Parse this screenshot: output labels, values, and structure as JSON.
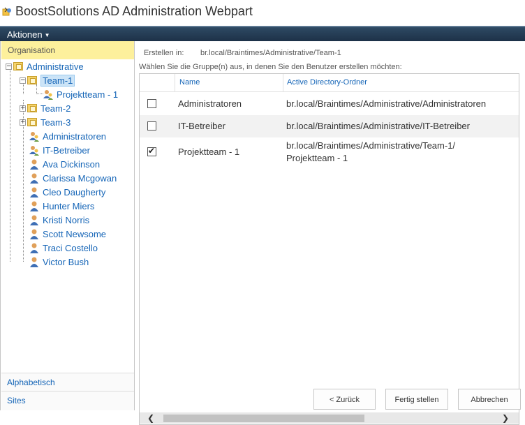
{
  "window": {
    "title": "BoostSolutions AD Administration Webpart",
    "icon": "app-logo-icon"
  },
  "menu": {
    "actions_label": "Aktionen"
  },
  "left": {
    "header": "Organisation",
    "tree": [
      {
        "label": "Administrative",
        "type": "folder",
        "toggle": "−"
      },
      {
        "label": "Team-1",
        "type": "folder",
        "toggle": "−",
        "selected": true
      },
      {
        "label": "Projektteam - 1",
        "type": "group"
      },
      {
        "label": "Team-2",
        "type": "folder",
        "toggle": "+"
      },
      {
        "label": "Team-3",
        "type": "folder",
        "toggle": "+"
      },
      {
        "label": "Administratoren",
        "type": "group"
      },
      {
        "label": "IT-Betreiber",
        "type": "group"
      },
      {
        "label": "Ava Dickinson",
        "type": "user"
      },
      {
        "label": "Clarissa Mcgowan",
        "type": "user"
      },
      {
        "label": "Cleo Daugherty",
        "type": "user"
      },
      {
        "label": "Hunter Miers",
        "type": "user"
      },
      {
        "label": "Kristi Norris",
        "type": "user"
      },
      {
        "label": "Scott Newsome",
        "type": "user"
      },
      {
        "label": "Traci Costello",
        "type": "user"
      },
      {
        "label": "Victor Bush",
        "type": "user"
      }
    ],
    "footer_alphabetical": "Alphabetisch",
    "footer_sites": "Sites"
  },
  "right": {
    "create_in_label": "Erstellen in:",
    "create_in_path": "br.local/Braintimes/Administrative/Team-1",
    "instruction": "Wählen Sie die Gruppe(n) aus, in denen Sie den Benutzer erstellen möchten:",
    "columns": {
      "name": "Name",
      "folder": "Active Directory-Ordner"
    },
    "rows": [
      {
        "checked": false,
        "name": "Administratoren",
        "folder_line1": "br.local/Braintimes/Administrative/Administratoren",
        "folder_line2": ""
      },
      {
        "checked": false,
        "name": "IT-Betreiber",
        "folder_line1": "br.local/Braintimes/Administrative/IT-Betreiber",
        "folder_line2": ""
      },
      {
        "checked": true,
        "name": "Projektteam - 1",
        "folder_line1": "br.local/Braintimes/Administrative/Team-1/",
        "folder_line2": "Projektteam - 1"
      }
    ],
    "scroll_left": "❮",
    "scroll_right": "❯"
  },
  "buttons": {
    "back": "< Zurück",
    "finish": "Fertig stellen",
    "cancel": "Abbrechen"
  }
}
